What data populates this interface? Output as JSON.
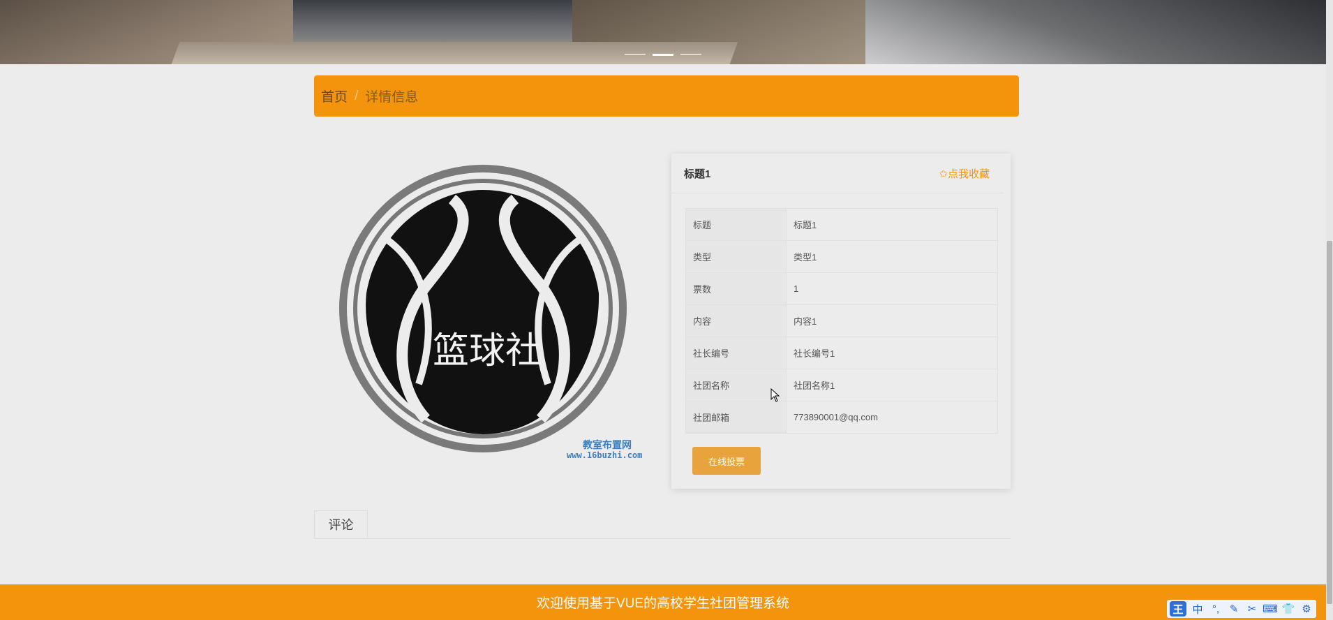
{
  "breadcrumb": {
    "home": "首页",
    "separator": "/",
    "current": "详情信息"
  },
  "logo": {
    "text": "篮球社",
    "watermark_line1": "教室布置网",
    "watermark_line2": "www.16buzhi.com"
  },
  "detail": {
    "title": "标题1",
    "favorite_label": "✩点我收藏",
    "rows": [
      {
        "key": "标题",
        "value": "标题1"
      },
      {
        "key": "类型",
        "value": "类型1"
      },
      {
        "key": "票数",
        "value": "1"
      },
      {
        "key": "内容",
        "value": "内容1"
      },
      {
        "key": "社长编号",
        "value": "社长编号1"
      },
      {
        "key": "社团名称",
        "value": "社团名称1"
      },
      {
        "key": "社团邮箱",
        "value": "773890001@qq.com"
      }
    ],
    "vote_button": "在线投票"
  },
  "tabs": {
    "comments": "评论"
  },
  "footer": {
    "text": "欢迎使用基于VUE的高校学生社团管理系统"
  },
  "ime": {
    "badge": "王",
    "mode": "中",
    "icons": [
      "punct-icon",
      "pen-icon",
      "scissors-icon",
      "keyboard-icon",
      "shirt-icon",
      "gear-icon"
    ]
  },
  "colors": {
    "accent": "#f4940c",
    "button": "#e8a33d",
    "background": "#ececec"
  }
}
